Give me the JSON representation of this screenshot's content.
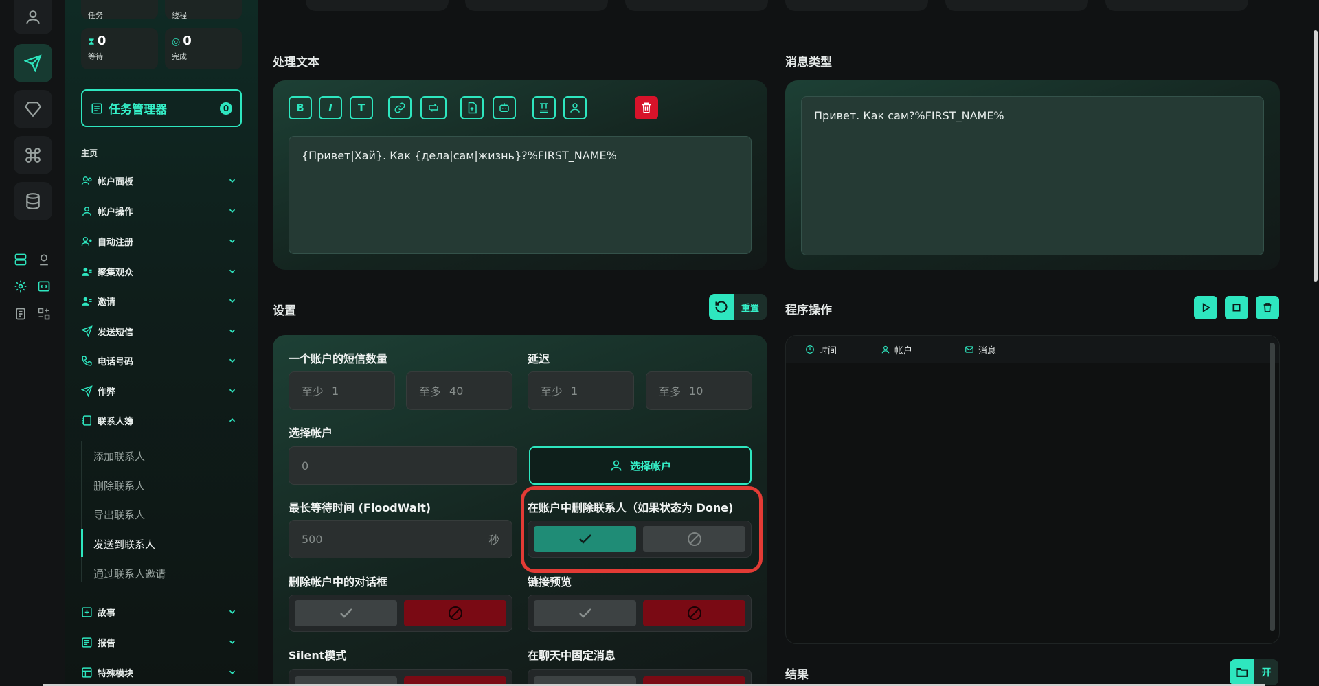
{
  "sidebar": {
    "stats": [
      {
        "label": "任务",
        "value": ""
      },
      {
        "label": "线程",
        "value": ""
      },
      {
        "label": "等待",
        "value": "0"
      },
      {
        "label": "完成",
        "value": "0"
      }
    ],
    "task_manager": {
      "label": "任务管理器",
      "badge": "0"
    },
    "section_title": "主页",
    "items": [
      {
        "label": "帐户面板"
      },
      {
        "label": "帐户操作"
      },
      {
        "label": "自动注册"
      },
      {
        "label": "聚集观众"
      },
      {
        "label": "邀请"
      },
      {
        "label": "发送短信"
      },
      {
        "label": "电话号码"
      },
      {
        "label": "作弊"
      },
      {
        "label": "联系人簿"
      },
      {
        "label": "故事"
      },
      {
        "label": "报告"
      },
      {
        "label": "特殊模块"
      }
    ],
    "contacts_sub": [
      "添加联系人",
      "删除联系人",
      "导出联系人",
      "发送到联系人",
      "通过联系人邀请"
    ]
  },
  "main": {
    "process_text": {
      "title": "处理文本",
      "toolbar": [
        "B",
        "I",
        "T"
      ],
      "text": "{Привет|Хай}. Как {дела|сам|жизнь}?%FIRST_NAME%"
    },
    "message_type": {
      "title": "消息类型",
      "text": "Привет. Как сам?%FIRST_NAME%"
    },
    "settings": {
      "title": "设置",
      "reset_label": "重置",
      "sms_count_label": "一个账户的短信数量",
      "delay_label": "延迟",
      "min_prefix": "至少",
      "max_prefix": "至多",
      "sms_min": "1",
      "sms_max": "40",
      "delay_min": "1",
      "delay_max": "10",
      "select_account_label": "选择帐户",
      "select_account_value": "0",
      "select_account_button": "选择帐户",
      "floodwait_label": "最长等待时间 (FloodWait)",
      "floodwait_value": "500",
      "floodwait_unit": "秒",
      "delete_contacts_label": "在账户中删除联系人（如果状态为 Done)",
      "delete_dialogs_label": "删除帐户中的对话框",
      "link_preview_label": "链接预览",
      "silent_label": "Silent模式",
      "pin_label": "在聊天中固定消息"
    },
    "program": {
      "title": "程序操作",
      "columns": [
        "时间",
        "帐户",
        "消息"
      ]
    },
    "results": {
      "title": "结果",
      "open_label": "开"
    }
  },
  "colors": {
    "accent": "#2ee6bf",
    "danger": "#d7132a",
    "highlight": "#e23b35"
  }
}
